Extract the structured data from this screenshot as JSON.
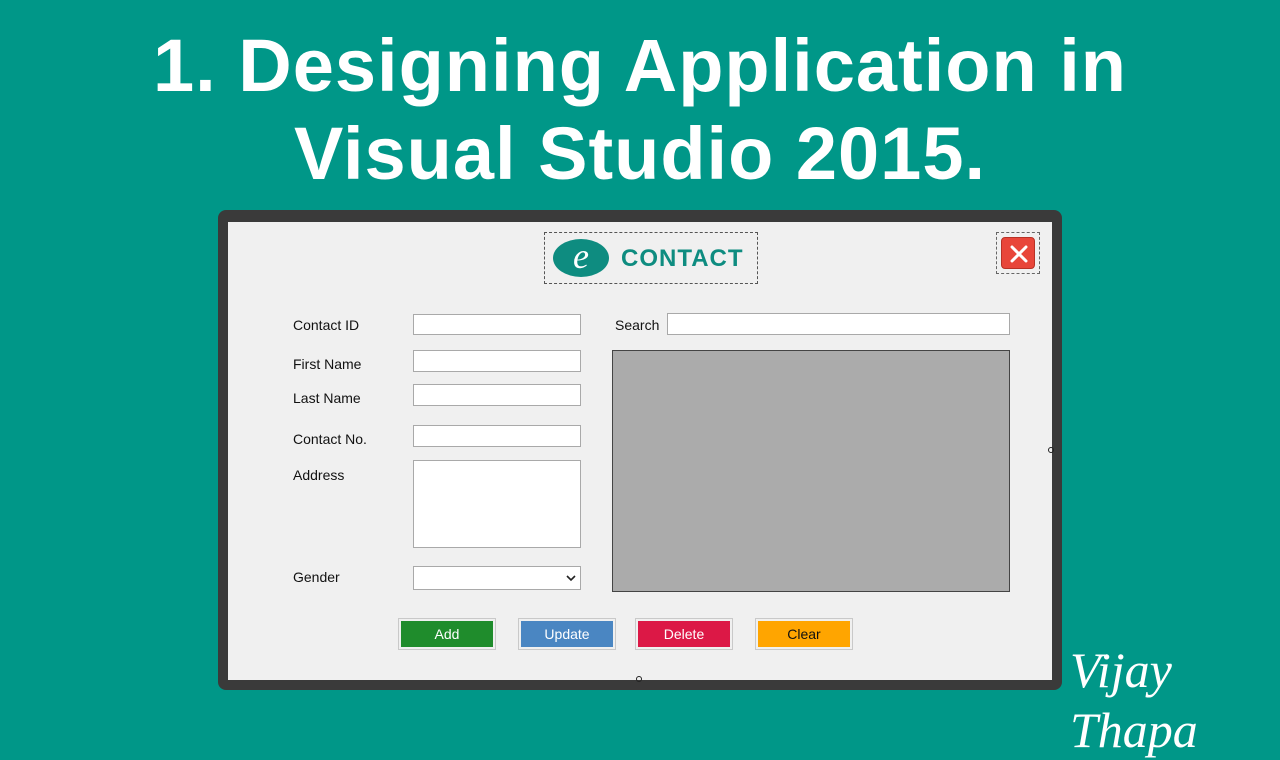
{
  "headline": {
    "line1": "1. Designing Application in",
    "line2": "Visual Studio 2015."
  },
  "logo": {
    "mark": "e",
    "text": "CONTACT"
  },
  "form": {
    "contact_id_label": "Contact ID",
    "first_name_label": "First Name",
    "last_name_label": "Last Name",
    "contact_no_label": "Contact No.",
    "address_label": "Address",
    "gender_label": "Gender",
    "search_label": "Search",
    "contact_id_value": "",
    "first_name_value": "",
    "last_name_value": "",
    "contact_no_value": "",
    "address_value": "",
    "search_value": "",
    "gender_value": ""
  },
  "buttons": {
    "add": "Add",
    "update": "Update",
    "delete": "Delete",
    "clear": "Clear"
  },
  "colors": {
    "background": "#009788",
    "add": "#1f8c2c",
    "update": "#4a86c2",
    "delete": "#dc1846",
    "clear": "#ffa500",
    "close": "#e8463a",
    "grid": "#ababab"
  },
  "icons": {
    "close": "close-icon",
    "dropdown": "chevron-down-icon"
  },
  "signature": "Vijay Thapa"
}
